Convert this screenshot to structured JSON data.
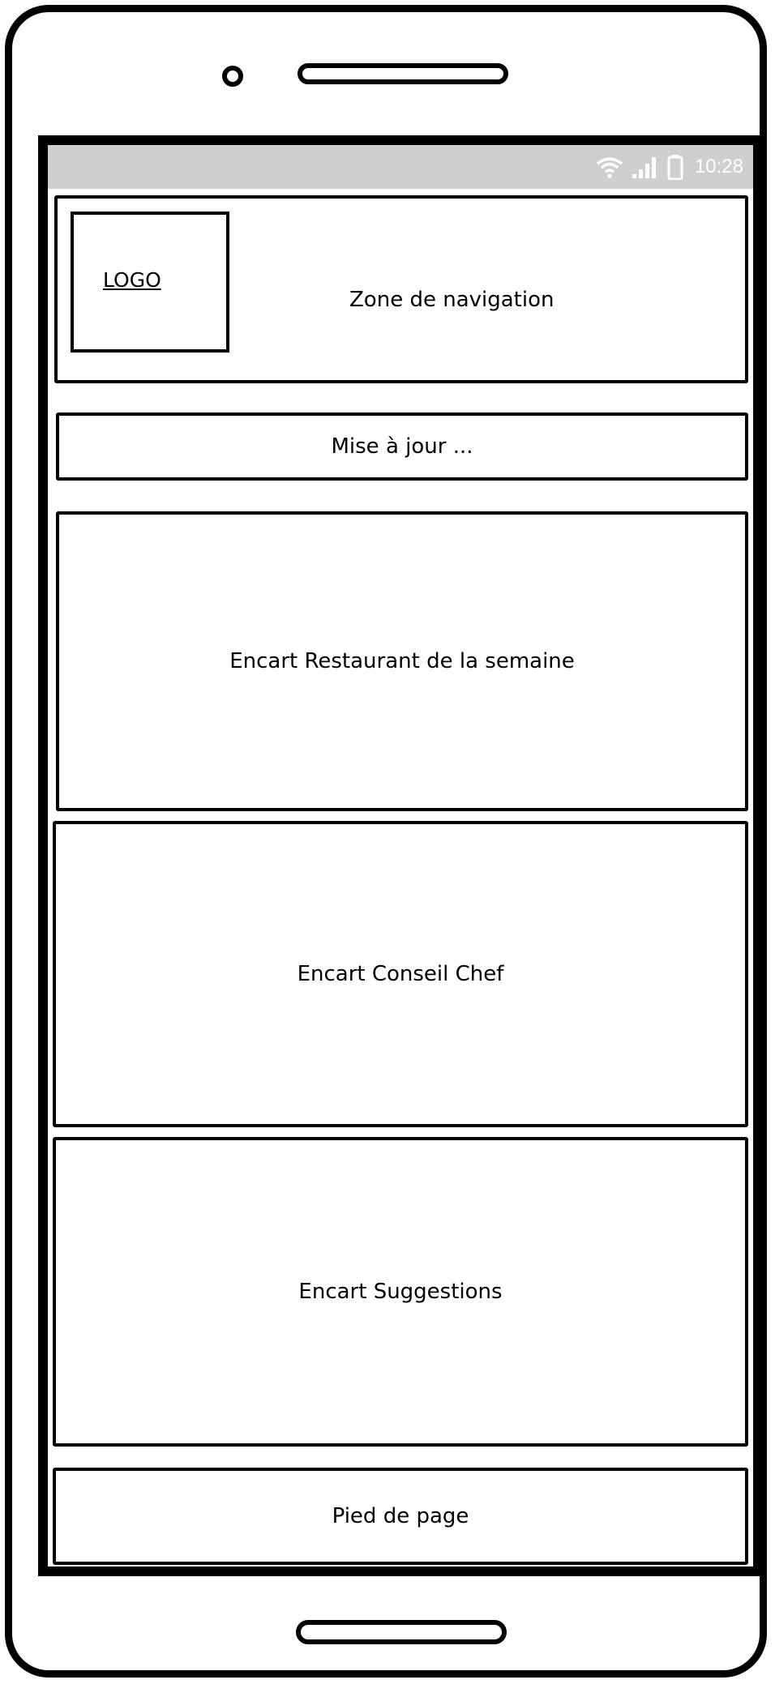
{
  "status_bar": {
    "time": "10:28",
    "icons": [
      "wifi-icon",
      "signal-icon",
      "battery-icon"
    ]
  },
  "header": {
    "logo_label": "LOGO",
    "nav_label": "Zone de navigation"
  },
  "update_bar": {
    "label": "Mise à jour ..."
  },
  "cards": {
    "restaurant": "Encart Restaurant de la semaine",
    "chef": "Encart Conseil Chef",
    "suggestions": "Encart Suggestions"
  },
  "footer": {
    "label": "Pied de page"
  },
  "colors": {
    "status_bar_bg": "#cfcfcf",
    "stroke": "#000000",
    "background": "#ffffff"
  }
}
